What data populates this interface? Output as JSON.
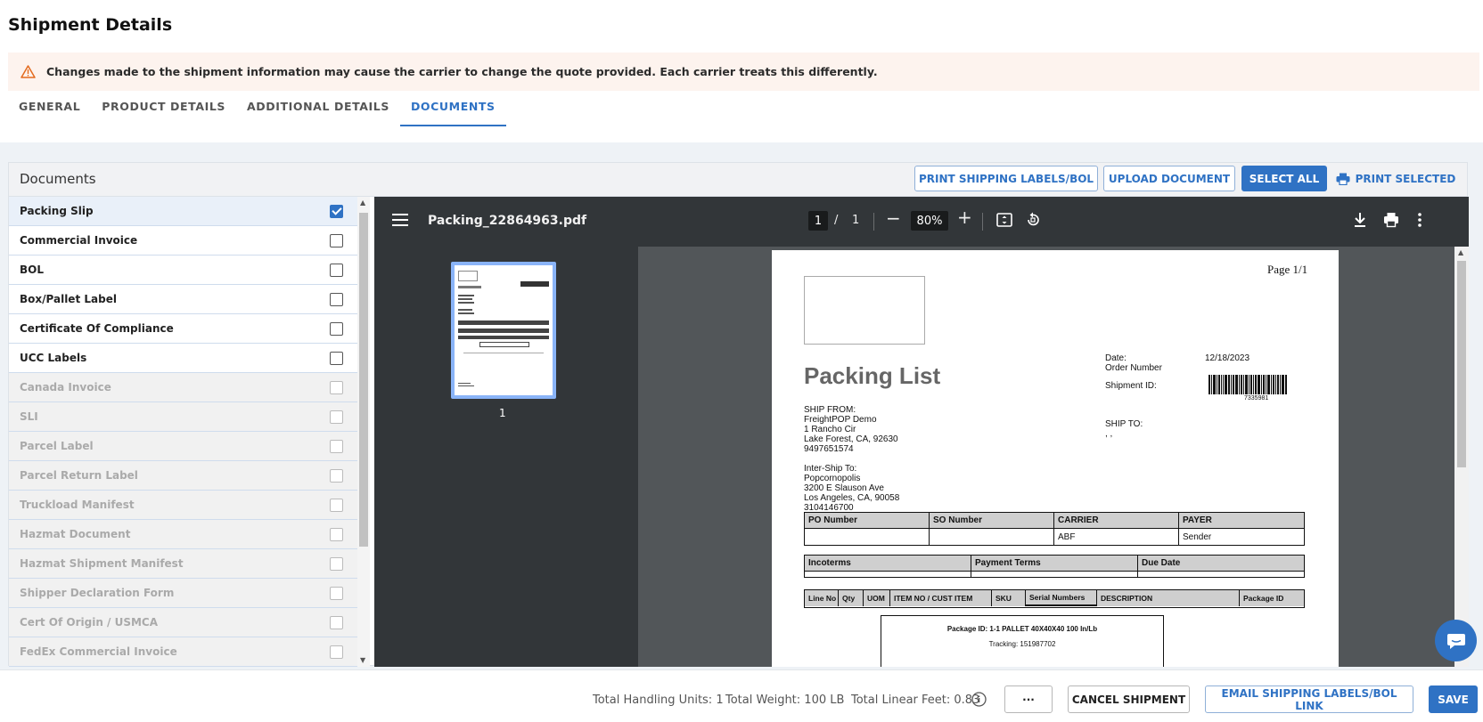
{
  "page": {
    "title": "Shipment Details"
  },
  "warning": {
    "text": "Changes made to the shipment information may cause the carrier to change the quote provided. Each carrier treats this differently.",
    "icon": "warning-triangle-icon"
  },
  "tabs": [
    {
      "label": "GENERAL",
      "active": false
    },
    {
      "label": "PRODUCT DETAILS",
      "active": false
    },
    {
      "label": "ADDITIONAL DETAILS",
      "active": false
    },
    {
      "label": "DOCUMENTS",
      "active": true
    }
  ],
  "documents": {
    "title": "Documents",
    "buttons": {
      "print_labels": "PRINT SHIPPING LABELS/BOL",
      "upload": "UPLOAD DOCUMENT",
      "select_all": "SELECT ALL",
      "print_selected": "PRINT SELECTED"
    },
    "items": [
      {
        "label": "Packing Slip",
        "checked": true,
        "enabled": true
      },
      {
        "label": "Commercial Invoice",
        "checked": false,
        "enabled": true
      },
      {
        "label": "BOL",
        "checked": false,
        "enabled": true
      },
      {
        "label": "Box/Pallet Label",
        "checked": false,
        "enabled": true
      },
      {
        "label": "Certificate Of Compliance",
        "checked": false,
        "enabled": true
      },
      {
        "label": "UCC Labels",
        "checked": false,
        "enabled": true
      },
      {
        "label": "Canada Invoice",
        "checked": false,
        "enabled": false
      },
      {
        "label": "SLI",
        "checked": false,
        "enabled": false
      },
      {
        "label": "Parcel Label",
        "checked": false,
        "enabled": false
      },
      {
        "label": "Parcel Return Label",
        "checked": false,
        "enabled": false
      },
      {
        "label": "Truckload Manifest",
        "checked": false,
        "enabled": false
      },
      {
        "label": "Hazmat Document",
        "checked": false,
        "enabled": false
      },
      {
        "label": "Hazmat Shipment Manifest",
        "checked": false,
        "enabled": false
      },
      {
        "label": "Shipper Declaration Form",
        "checked": false,
        "enabled": false
      },
      {
        "label": "Cert Of Origin / USMCA",
        "checked": false,
        "enabled": false
      },
      {
        "label": "FedEx Commercial Invoice",
        "checked": false,
        "enabled": false
      }
    ]
  },
  "viewer": {
    "filename": "Packing_22864963.pdf",
    "current_page": "1",
    "page_separator": "/",
    "total_pages": "1",
    "zoom": "80%",
    "thumbnail_label": "1"
  },
  "pdf": {
    "page_label": "Page 1/1",
    "title": "Packing List",
    "date_label": "Date:",
    "date_value": "12/18/2023",
    "order_number_label": "Order Number",
    "shipment_id_label": "Shipment ID:",
    "barcode_number": "7335981",
    "ship_from_label": "SHIP FROM:",
    "ship_from_lines": [
      "FreightPOP Demo",
      "1 Rancho Cir",
      "Lake Forest, CA, 92630",
      "9497651574"
    ],
    "inter_ship_label": "Inter-Ship To:",
    "inter_ship_lines": [
      "Popcornopolis",
      "3200 E Slauson Ave",
      "Los Angeles, CA, 90058",
      "3104146700"
    ],
    "ship_to_label": "SHIP TO:",
    "ship_to_value": ", ,",
    "table1_headers": [
      "PO Number",
      "SO Number",
      "CARRIER",
      "PAYER"
    ],
    "table1_values": [
      "",
      "",
      "ABF",
      "Sender"
    ],
    "table2_headers": [
      "Incoterms",
      "Payment Terms",
      "Due Date"
    ],
    "table3_headers": [
      "Line No",
      "Qty",
      "UOM",
      "ITEM NO / CUST ITEM",
      "SKU",
      "Serial Numbers",
      "DESCRIPTION",
      "Package ID"
    ],
    "package_id_line": "Package ID: 1-1 PALLET 40X40X40 100 In/Lb",
    "tracking_line": "Tracking: 151987702"
  },
  "footer": {
    "handling_units": "Total Handling Units: 1",
    "weight": "Total Weight: 100 LB",
    "linear_feet": "Total Linear Feet: 0.83",
    "more_label": "···",
    "cancel_label": "CANCEL SHIPMENT",
    "email_label": "EMAIL SHIPPING LABELS/BOL LINK",
    "save_label": "SAVE"
  },
  "colors": {
    "accent": "#2f72c4",
    "warning_bg": "#fdf3ee",
    "viewer_toolbar": "#323639"
  }
}
